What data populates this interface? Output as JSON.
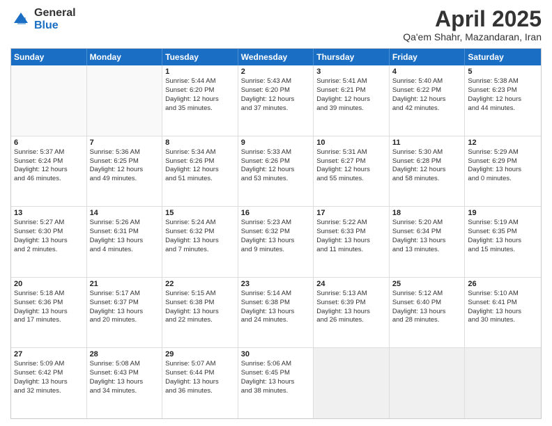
{
  "logo": {
    "general": "General",
    "blue": "Blue"
  },
  "header": {
    "title": "April 2025",
    "subtitle": "Qa'em Shahr, Mazandaran, Iran"
  },
  "days": [
    "Sunday",
    "Monday",
    "Tuesday",
    "Wednesday",
    "Thursday",
    "Friday",
    "Saturday"
  ],
  "rows": [
    [
      {
        "num": "",
        "lines": [],
        "empty": true
      },
      {
        "num": "",
        "lines": [],
        "empty": true
      },
      {
        "num": "1",
        "lines": [
          "Sunrise: 5:44 AM",
          "Sunset: 6:20 PM",
          "Daylight: 12 hours",
          "and 35 minutes."
        ]
      },
      {
        "num": "2",
        "lines": [
          "Sunrise: 5:43 AM",
          "Sunset: 6:20 PM",
          "Daylight: 12 hours",
          "and 37 minutes."
        ]
      },
      {
        "num": "3",
        "lines": [
          "Sunrise: 5:41 AM",
          "Sunset: 6:21 PM",
          "Daylight: 12 hours",
          "and 39 minutes."
        ]
      },
      {
        "num": "4",
        "lines": [
          "Sunrise: 5:40 AM",
          "Sunset: 6:22 PM",
          "Daylight: 12 hours",
          "and 42 minutes."
        ]
      },
      {
        "num": "5",
        "lines": [
          "Sunrise: 5:38 AM",
          "Sunset: 6:23 PM",
          "Daylight: 12 hours",
          "and 44 minutes."
        ]
      }
    ],
    [
      {
        "num": "6",
        "lines": [
          "Sunrise: 5:37 AM",
          "Sunset: 6:24 PM",
          "Daylight: 12 hours",
          "and 46 minutes."
        ]
      },
      {
        "num": "7",
        "lines": [
          "Sunrise: 5:36 AM",
          "Sunset: 6:25 PM",
          "Daylight: 12 hours",
          "and 49 minutes."
        ]
      },
      {
        "num": "8",
        "lines": [
          "Sunrise: 5:34 AM",
          "Sunset: 6:26 PM",
          "Daylight: 12 hours",
          "and 51 minutes."
        ]
      },
      {
        "num": "9",
        "lines": [
          "Sunrise: 5:33 AM",
          "Sunset: 6:26 PM",
          "Daylight: 12 hours",
          "and 53 minutes."
        ]
      },
      {
        "num": "10",
        "lines": [
          "Sunrise: 5:31 AM",
          "Sunset: 6:27 PM",
          "Daylight: 12 hours",
          "and 55 minutes."
        ]
      },
      {
        "num": "11",
        "lines": [
          "Sunrise: 5:30 AM",
          "Sunset: 6:28 PM",
          "Daylight: 12 hours",
          "and 58 minutes."
        ]
      },
      {
        "num": "12",
        "lines": [
          "Sunrise: 5:29 AM",
          "Sunset: 6:29 PM",
          "Daylight: 13 hours",
          "and 0 minutes."
        ]
      }
    ],
    [
      {
        "num": "13",
        "lines": [
          "Sunrise: 5:27 AM",
          "Sunset: 6:30 PM",
          "Daylight: 13 hours",
          "and 2 minutes."
        ]
      },
      {
        "num": "14",
        "lines": [
          "Sunrise: 5:26 AM",
          "Sunset: 6:31 PM",
          "Daylight: 13 hours",
          "and 4 minutes."
        ]
      },
      {
        "num": "15",
        "lines": [
          "Sunrise: 5:24 AM",
          "Sunset: 6:32 PM",
          "Daylight: 13 hours",
          "and 7 minutes."
        ]
      },
      {
        "num": "16",
        "lines": [
          "Sunrise: 5:23 AM",
          "Sunset: 6:32 PM",
          "Daylight: 13 hours",
          "and 9 minutes."
        ]
      },
      {
        "num": "17",
        "lines": [
          "Sunrise: 5:22 AM",
          "Sunset: 6:33 PM",
          "Daylight: 13 hours",
          "and 11 minutes."
        ]
      },
      {
        "num": "18",
        "lines": [
          "Sunrise: 5:20 AM",
          "Sunset: 6:34 PM",
          "Daylight: 13 hours",
          "and 13 minutes."
        ]
      },
      {
        "num": "19",
        "lines": [
          "Sunrise: 5:19 AM",
          "Sunset: 6:35 PM",
          "Daylight: 13 hours",
          "and 15 minutes."
        ]
      }
    ],
    [
      {
        "num": "20",
        "lines": [
          "Sunrise: 5:18 AM",
          "Sunset: 6:36 PM",
          "Daylight: 13 hours",
          "and 17 minutes."
        ]
      },
      {
        "num": "21",
        "lines": [
          "Sunrise: 5:17 AM",
          "Sunset: 6:37 PM",
          "Daylight: 13 hours",
          "and 20 minutes."
        ]
      },
      {
        "num": "22",
        "lines": [
          "Sunrise: 5:15 AM",
          "Sunset: 6:38 PM",
          "Daylight: 13 hours",
          "and 22 minutes."
        ]
      },
      {
        "num": "23",
        "lines": [
          "Sunrise: 5:14 AM",
          "Sunset: 6:38 PM",
          "Daylight: 13 hours",
          "and 24 minutes."
        ]
      },
      {
        "num": "24",
        "lines": [
          "Sunrise: 5:13 AM",
          "Sunset: 6:39 PM",
          "Daylight: 13 hours",
          "and 26 minutes."
        ]
      },
      {
        "num": "25",
        "lines": [
          "Sunrise: 5:12 AM",
          "Sunset: 6:40 PM",
          "Daylight: 13 hours",
          "and 28 minutes."
        ]
      },
      {
        "num": "26",
        "lines": [
          "Sunrise: 5:10 AM",
          "Sunset: 6:41 PM",
          "Daylight: 13 hours",
          "and 30 minutes."
        ]
      }
    ],
    [
      {
        "num": "27",
        "lines": [
          "Sunrise: 5:09 AM",
          "Sunset: 6:42 PM",
          "Daylight: 13 hours",
          "and 32 minutes."
        ]
      },
      {
        "num": "28",
        "lines": [
          "Sunrise: 5:08 AM",
          "Sunset: 6:43 PM",
          "Daylight: 13 hours",
          "and 34 minutes."
        ]
      },
      {
        "num": "29",
        "lines": [
          "Sunrise: 5:07 AM",
          "Sunset: 6:44 PM",
          "Daylight: 13 hours",
          "and 36 minutes."
        ]
      },
      {
        "num": "30",
        "lines": [
          "Sunrise: 5:06 AM",
          "Sunset: 6:45 PM",
          "Daylight: 13 hours",
          "and 38 minutes."
        ]
      },
      {
        "num": "",
        "lines": [],
        "empty": true,
        "shaded": true
      },
      {
        "num": "",
        "lines": [],
        "empty": true,
        "shaded": true
      },
      {
        "num": "",
        "lines": [],
        "empty": true,
        "shaded": true
      }
    ]
  ]
}
